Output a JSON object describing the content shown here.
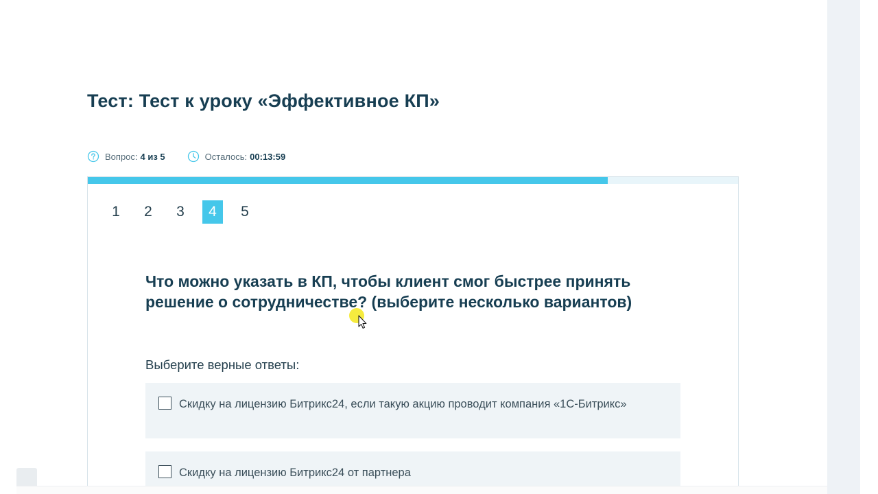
{
  "test": {
    "title": "Тест: Тест к уроку «Эффективное КП»",
    "question_label": "Вопрос:",
    "question_value": "4 из 5",
    "remaining_label": "Осталось:",
    "remaining_value": "00:13:59",
    "progress_fraction": 0.8
  },
  "pager": {
    "pages": [
      "1",
      "2",
      "3",
      "4",
      "5"
    ],
    "active": "4"
  },
  "question": {
    "text": "Что можно указать в КП, чтобы клиент смог быстрее принять решение о сотрудничестве? (выберите несколько вариантов)",
    "instruction": "Выберите верные ответы:",
    "options": [
      "Скидку на лицензию Битрикс24, если такую акцию проводит компания «1С-Битрикс»",
      "Скидку на лицензию Битрикс24 от партнера"
    ]
  },
  "colors": {
    "accent": "#45c7ea",
    "top_bar": "#bfd730",
    "title": "#173e52",
    "option_bg": "#eff4f7",
    "cursor_highlight": "#f5e81c"
  },
  "icons": {
    "question": "question-circle-icon",
    "timer": "clock-icon",
    "pointer": "mouse-pointer-icon"
  }
}
